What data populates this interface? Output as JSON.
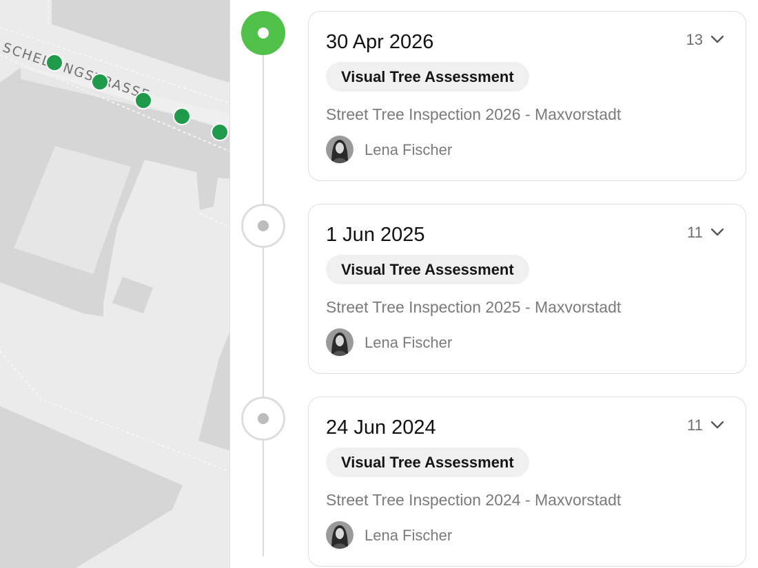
{
  "map": {
    "street_label": "SCHELLINGSTRASSE",
    "tree_marker_color": "#1f9a4b"
  },
  "timeline": {
    "active_color": "#52c14a",
    "items": [
      {
        "date": "30 Apr 2026",
        "count": "13",
        "tag": "Visual Tree Assessment",
        "project": "Street Tree Inspection 2026 - Maxvorstadt",
        "user": "Lena Fischer",
        "active": true
      },
      {
        "date": "1 Jun 2025",
        "count": "11",
        "tag": "Visual Tree Assessment",
        "project": "Street Tree Inspection 2025 - Maxvorstadt",
        "user": "Lena Fischer",
        "active": false
      },
      {
        "date": "24 Jun 2024",
        "count": "11",
        "tag": "Visual Tree Assessment",
        "project": "Street Tree Inspection 2024 - Maxvorstadt",
        "user": "Lena Fischer",
        "active": false
      }
    ]
  },
  "icons": {
    "expand": "chevron-down-icon",
    "avatar": "user-avatar"
  }
}
